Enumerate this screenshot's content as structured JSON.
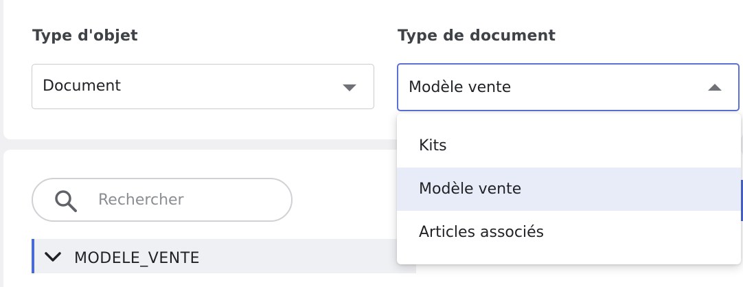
{
  "filters": {
    "object_type": {
      "label": "Type d'objet",
      "value": "Document",
      "icon": "caret-down-icon"
    },
    "document_type": {
      "label": "Type de document",
      "value": "Modèle vente",
      "icon": "caret-up-icon",
      "open": true,
      "options": [
        "Kits",
        "Modèle vente",
        "Articles associés"
      ],
      "selected_index": 1
    }
  },
  "search": {
    "placeholder": "Rechercher",
    "icon": "search-icon"
  },
  "tree": {
    "items": [
      {
        "label": "MODELE_VENTE",
        "expanded": true,
        "icon": "chevron-down-icon"
      }
    ]
  },
  "colors": {
    "accent": "#5b6fd6",
    "selected_bg": "#e8ecf8",
    "background": "#f0f0f2"
  }
}
